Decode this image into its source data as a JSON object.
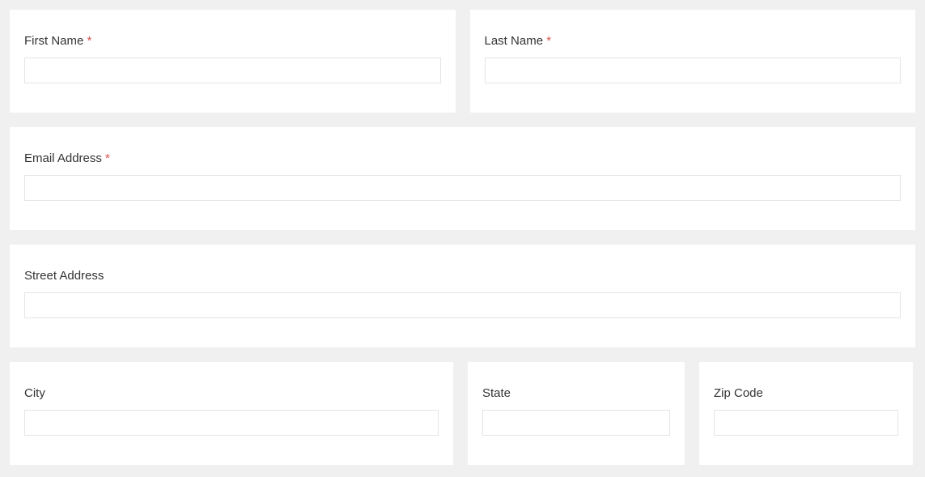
{
  "fields": {
    "first_name": {
      "label": "First Name",
      "required": true
    },
    "last_name": {
      "label": "Last Name",
      "required": true
    },
    "email": {
      "label": "Email Address",
      "required": true
    },
    "street": {
      "label": "Street Address",
      "required": false
    },
    "city": {
      "label": "City",
      "required": false
    },
    "state": {
      "label": "State",
      "required": false
    },
    "zip": {
      "label": "Zip Code",
      "required": false
    }
  },
  "required_marker": "*"
}
